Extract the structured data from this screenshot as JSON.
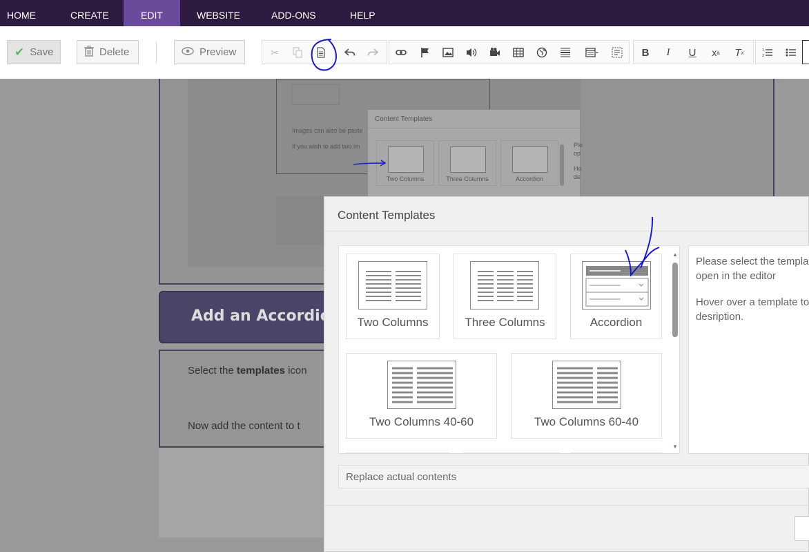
{
  "nav": {
    "items": [
      "HOME",
      "CREATE",
      "EDIT",
      "WEBSITE",
      "ADD-ONS",
      "HELP"
    ],
    "active": "EDIT"
  },
  "toolbar": {
    "save_label": "Save",
    "delete_label": "Delete",
    "preview_label": "Preview",
    "icons": [
      "cut-icon",
      "copy-icon",
      "templates-icon",
      "undo-icon",
      "redo-icon",
      "link-icon",
      "flag-icon",
      "image-icon",
      "audio-icon",
      "video-icon",
      "table-icon",
      "globe-icon",
      "horizontal-rule-icon",
      "block-icon",
      "select-all-icon",
      "bold-icon",
      "italic-icon",
      "underline-icon",
      "superscript-icon",
      "remove-format-icon",
      "numbered-list-icon",
      "bullet-list-icon"
    ]
  },
  "background": {
    "inner_dialog_title": "Content Templates",
    "inner_cards": [
      "Two Columns",
      "Three Columns",
      "Accordion"
    ],
    "inner_text_1": "Images can also be paste",
    "inner_text_2": "If you wish to add two im",
    "inner_side_1": "Ple",
    "inner_side_2": "op",
    "inner_side_3": "Ho",
    "inner_side_4": "de",
    "accordion_button": "Add an Accordion",
    "instruction_1_pre": "Select the ",
    "instruction_1_bold": "templates",
    "instruction_1_post": " icon",
    "instruction_2": "Now add the content to t"
  },
  "modal": {
    "title": "Content Templates",
    "templates": [
      "Two Columns",
      "Three Columns",
      "Accordion",
      "Two Columns 40-60",
      "Two Columns 60-40"
    ],
    "description_line1": "Please select the templat",
    "description_line2": "open in the editor",
    "description_line3": "Hover over a template to",
    "description_line4": "desription.",
    "replace_label": "Replace actual contents"
  },
  "colors": {
    "nav_bg": "#2e1a3f",
    "nav_active": "#6a4a9b",
    "annotation": "#1a1acc"
  }
}
